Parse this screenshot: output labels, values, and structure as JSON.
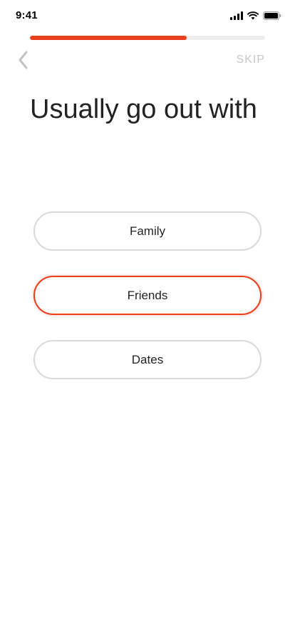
{
  "status_bar": {
    "time": "9:41",
    "icons": [
      "cellular-signal-icon",
      "wifi-icon",
      "battery-icon"
    ]
  },
  "progress": {
    "fraction": 0.667,
    "fill_color": "#e8401c",
    "track_color": "#eeeeee"
  },
  "nav": {
    "back_icon": "chevron-left-icon",
    "skip_label": "SKIP"
  },
  "title": "Usually go out with",
  "options": [
    {
      "label": "Family",
      "selected": false
    },
    {
      "label": "Friends",
      "selected": true
    },
    {
      "label": "Dates",
      "selected": false
    }
  ],
  "colors": {
    "accent": "#e8401c",
    "option_border": "#d9d9d9",
    "skip_text": "#c6c6c6"
  }
}
